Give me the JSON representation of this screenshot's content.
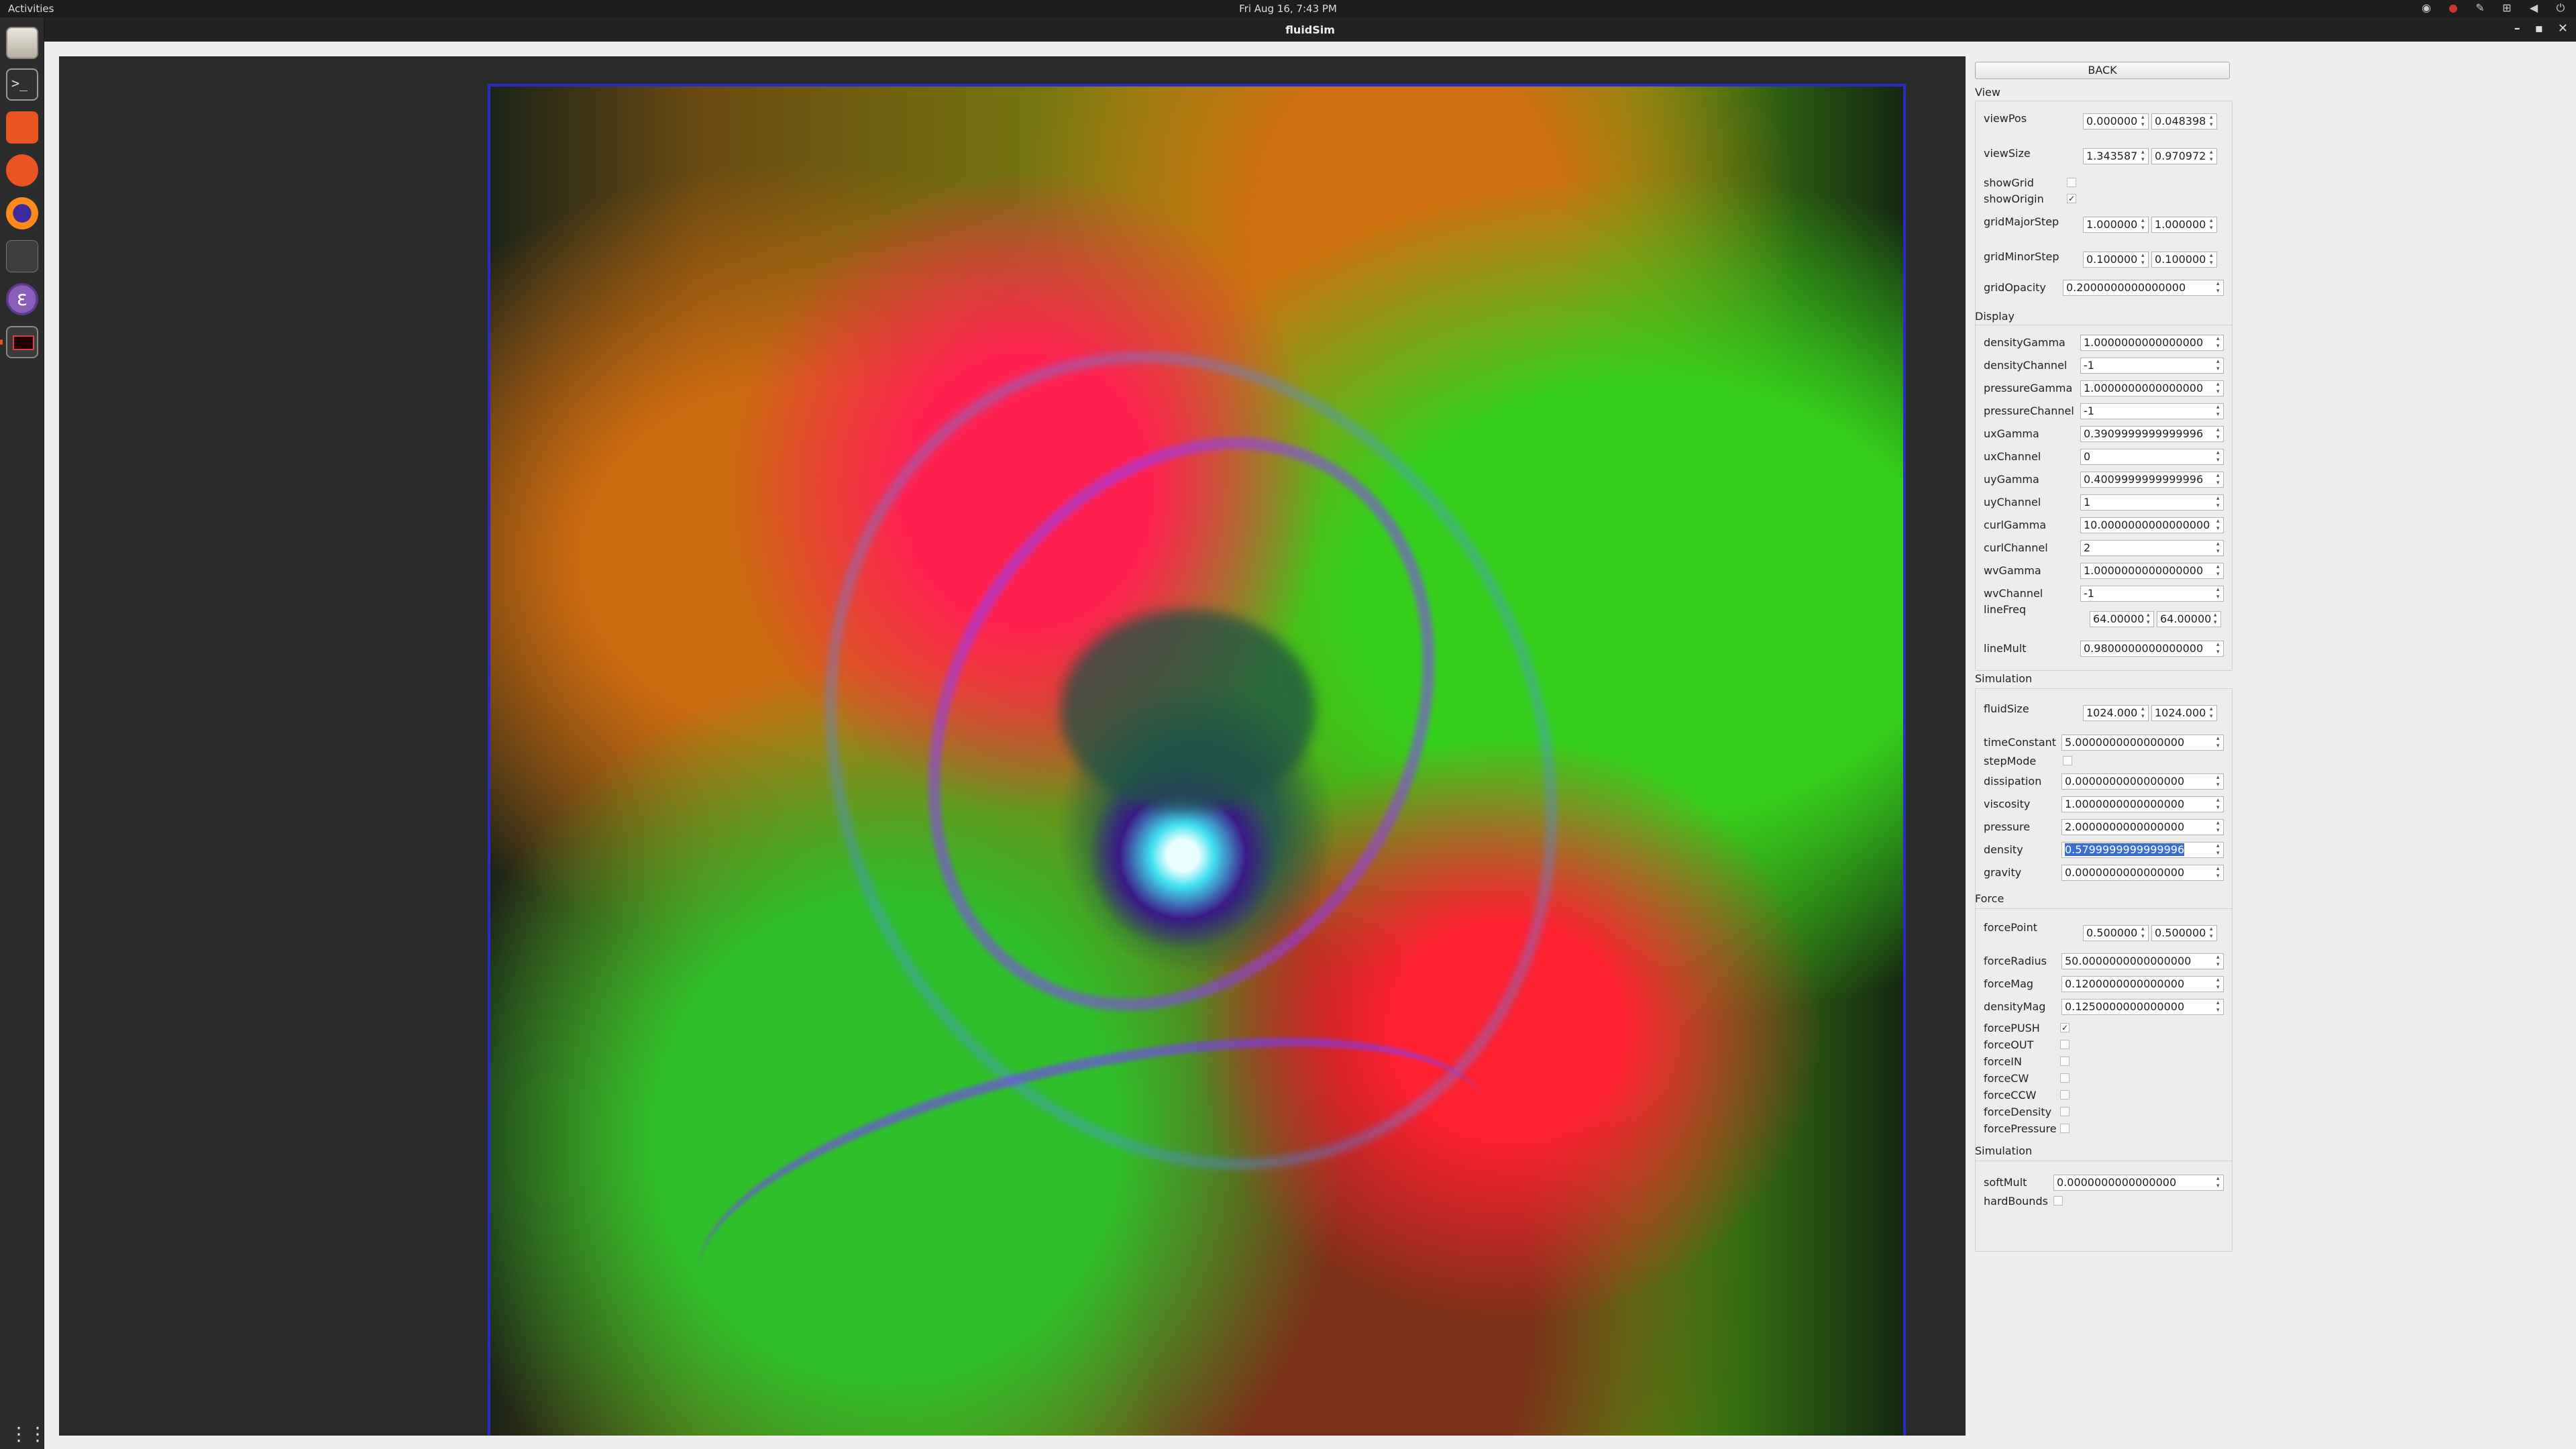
{
  "topbar": {
    "activities": "Activities",
    "clock": "Fri Aug 16,  7:43 PM"
  },
  "window": {
    "title": "fluidSim"
  },
  "panel": {
    "back_label": "BACK",
    "view": {
      "title": "View",
      "viewPos_label": "viewPos",
      "viewPos_x": "0.000000",
      "viewPos_y": "0.048398",
      "viewSize_label": "viewSize",
      "viewSize_x": "1.343587",
      "viewSize_y": "0.970972",
      "showGrid_label": "showGrid",
      "showGrid": false,
      "showOrigin_label": "showOrigin",
      "showOrigin": true,
      "gridMajorStep_label": "gridMajorStep",
      "gridMajorStep_x": "1.000000",
      "gridMajorStep_y": "1.000000",
      "gridMinorStep_label": "gridMinorStep",
      "gridMinorStep_x": "0.100000",
      "gridMinorStep_y": "0.100000",
      "gridOpacity_label": "gridOpacity",
      "gridOpacity": "0.2000000000000000"
    },
    "display": {
      "title": "Display",
      "rows": [
        {
          "label": "densityGamma",
          "value": "1.0000000000000000"
        },
        {
          "label": "densityChannel",
          "value": "-1"
        },
        {
          "label": "pressureGamma",
          "value": "1.0000000000000000"
        },
        {
          "label": "pressureChannel",
          "value": "-1"
        },
        {
          "label": "uxGamma",
          "value": "0.3909999999999996"
        },
        {
          "label": "uxChannel",
          "value": "0"
        },
        {
          "label": "uyGamma",
          "value": "0.4009999999999996"
        },
        {
          "label": "uyChannel",
          "value": "1"
        },
        {
          "label": "curlGamma",
          "value": "10.0000000000000000"
        },
        {
          "label": "curlChannel",
          "value": "2"
        },
        {
          "label": "wvGamma",
          "value": "1.0000000000000000"
        },
        {
          "label": "wvChannel",
          "value": "-1"
        }
      ],
      "lineFreq_label": "lineFreq",
      "lineFreq_x": "64.00000",
      "lineFreq_y": "64.00000",
      "lineMult_label": "lineMult",
      "lineMult": "0.9800000000000000"
    },
    "simulation": {
      "title": "Simulation",
      "fluidSize_label": "fluidSize",
      "fluidSize_x": "1024.000",
      "fluidSize_y": "1024.000",
      "timeConstant_label": "timeConstant",
      "timeConstant": "5.0000000000000000",
      "stepMode_label": "stepMode",
      "stepMode": false,
      "dissipation_label": "dissipation",
      "dissipation": "0.0000000000000000",
      "viscosity_label": "viscosity",
      "viscosity": "1.0000000000000000",
      "pressure_label": "pressure",
      "pressure": "2.0000000000000000",
      "density_label": "density",
      "density": "0.5799999999999996",
      "gravity_label": "gravity",
      "gravity": "0.0000000000000000"
    },
    "force": {
      "title": "Force",
      "forcePoint_label": "forcePoint",
      "forcePoint_x": "0.500000",
      "forcePoint_y": "0.500000",
      "forceRadius_label": "forceRadius",
      "forceRadius": "50.0000000000000000",
      "forceMag_label": "forceMag",
      "forceMag": "0.1200000000000000",
      "densityMag_label": "densityMag",
      "densityMag": "0.1250000000000000",
      "checks": [
        {
          "label": "forcePUSH",
          "checked": true
        },
        {
          "label": "forceOUT",
          "checked": false
        },
        {
          "label": "forceIN",
          "checked": false
        },
        {
          "label": "forceCW",
          "checked": false
        },
        {
          "label": "forceCCW",
          "checked": false
        },
        {
          "label": "forceDensity",
          "checked": false
        },
        {
          "label": "forcePressure",
          "checked": false
        }
      ]
    },
    "simulation2": {
      "title": "Simulation",
      "softMult_label": "softMult",
      "softMult": "0.0000000000000000",
      "hardBounds_label": "hardBounds",
      "hardBounds": false
    }
  },
  "icons": {
    "check_mark": "✓"
  }
}
